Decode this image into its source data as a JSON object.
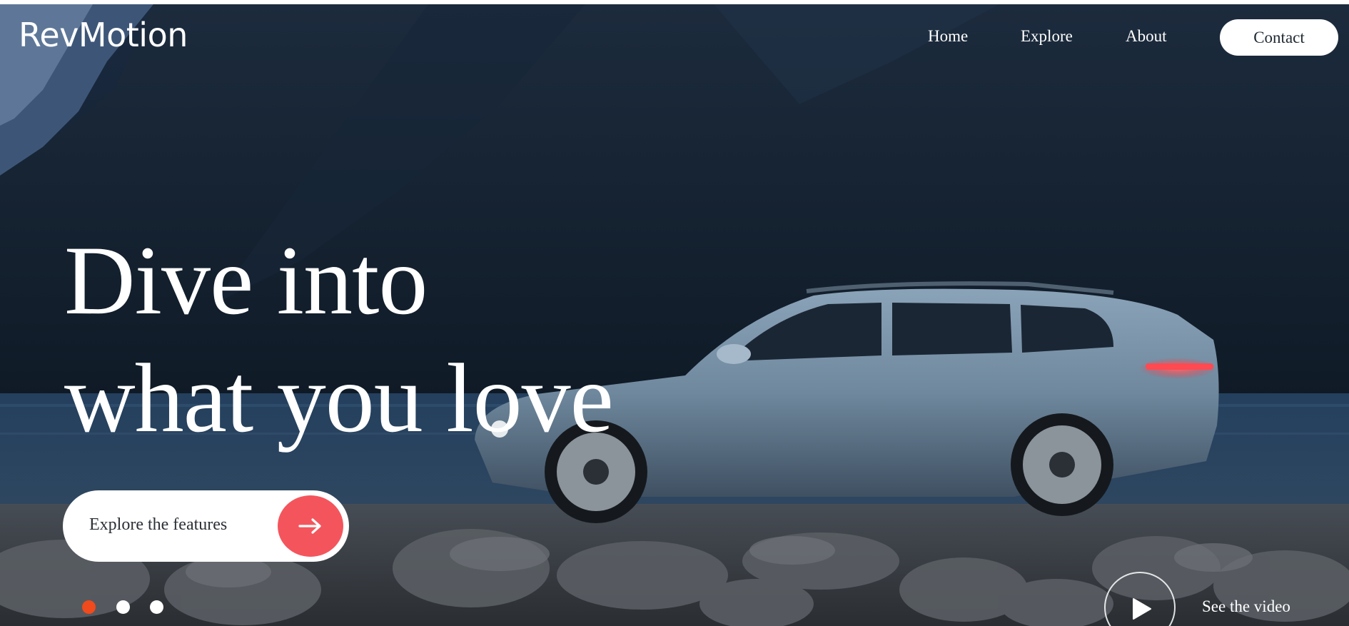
{
  "brand": {
    "name": "RevMotion"
  },
  "nav": {
    "items": [
      {
        "label": "Home"
      },
      {
        "label": "Explore"
      },
      {
        "label": "About"
      }
    ],
    "contact_label": "Contact"
  },
  "hero": {
    "headline_line1": "Dive into",
    "headline_line2": "what you love",
    "cta_label": "Explore the features",
    "carousel": {
      "slide_count": 3,
      "active_index": 0
    },
    "video_label": "See the video"
  },
  "colors": {
    "accent_red": "#f4555c",
    "active_dot": "#f14a1c",
    "text_on_dark": "#ffffff",
    "button_bg": "#ffffff"
  },
  "icons": {
    "cta_icon": "arrow-right-icon",
    "video_icon": "play-icon"
  }
}
